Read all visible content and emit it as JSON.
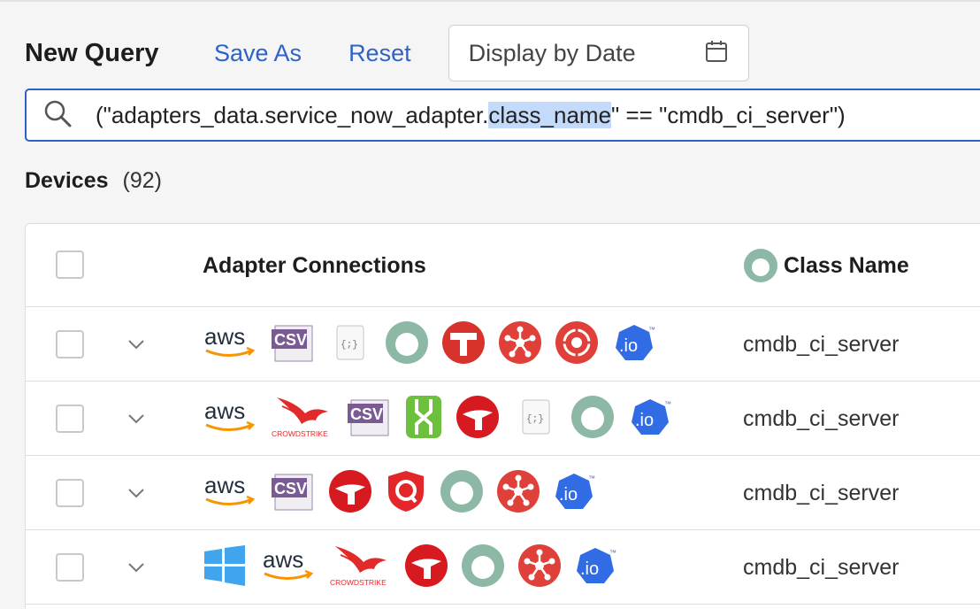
{
  "header": {
    "title": "New Query",
    "save_as": "Save As",
    "reset": "Reset",
    "date_picker_label": "Display by Date"
  },
  "search": {
    "query_prefix": "(\"adapters_data.service_now_adapter.",
    "query_highlight": "class_name",
    "query_suffix": "\" == \"cmdb_ci_server\")"
  },
  "devices": {
    "title": "Devices",
    "count": "(92)"
  },
  "table": {
    "columns": {
      "adapters": "Adapter Connections",
      "class_name": "Class Name"
    },
    "rows": [
      {
        "adapters": [
          "aws",
          "csv",
          "json",
          "service-now",
          "tanium",
          "hub",
          "target",
          "io"
        ],
        "class_name": "cmdb_ci_server"
      },
      {
        "adapters": [
          "aws",
          "crowdstrike",
          "csv",
          "sentinelone",
          "trendmicro",
          "json",
          "service-now",
          "io"
        ],
        "class_name": "cmdb_ci_server"
      },
      {
        "adapters": [
          "aws",
          "csv",
          "trendmicro",
          "qualys",
          "service-now",
          "hub",
          "io"
        ],
        "class_name": "cmdb_ci_server"
      },
      {
        "adapters": [
          "windows",
          "aws",
          "crowdstrike",
          "trendmicro",
          "service-now",
          "hub",
          "io"
        ],
        "class_name": "cmdb_ci_server"
      }
    ]
  },
  "brand_text": {
    "aws": "aws",
    "csv": "CSV",
    "io": ".io",
    "tm": "™",
    "crowdstrike": "CROWDSTRIKE",
    "json": "{;}"
  },
  "colors": {
    "accent": "#2e62c9",
    "highlight": "#c3dafb",
    "service_now": "#8db8a6",
    "red": "#d7332c",
    "io_blue": "#326ce5"
  }
}
